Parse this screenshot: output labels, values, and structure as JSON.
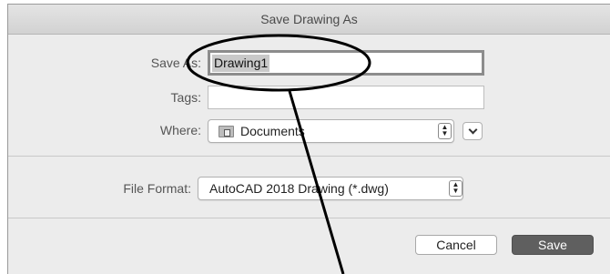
{
  "dialog": {
    "title": "Save Drawing As",
    "save_as": {
      "label": "Save As:",
      "value": "Drawing1"
    },
    "tags": {
      "label": "Tags:",
      "value": ""
    },
    "where": {
      "label": "Where:",
      "value": "Documents",
      "icon": "folder-icon"
    },
    "file_format": {
      "label": "File Format:",
      "value": "AutoCAD 2018 Drawing (*.dwg)"
    },
    "buttons": {
      "cancel": "Cancel",
      "save": "Save"
    }
  }
}
